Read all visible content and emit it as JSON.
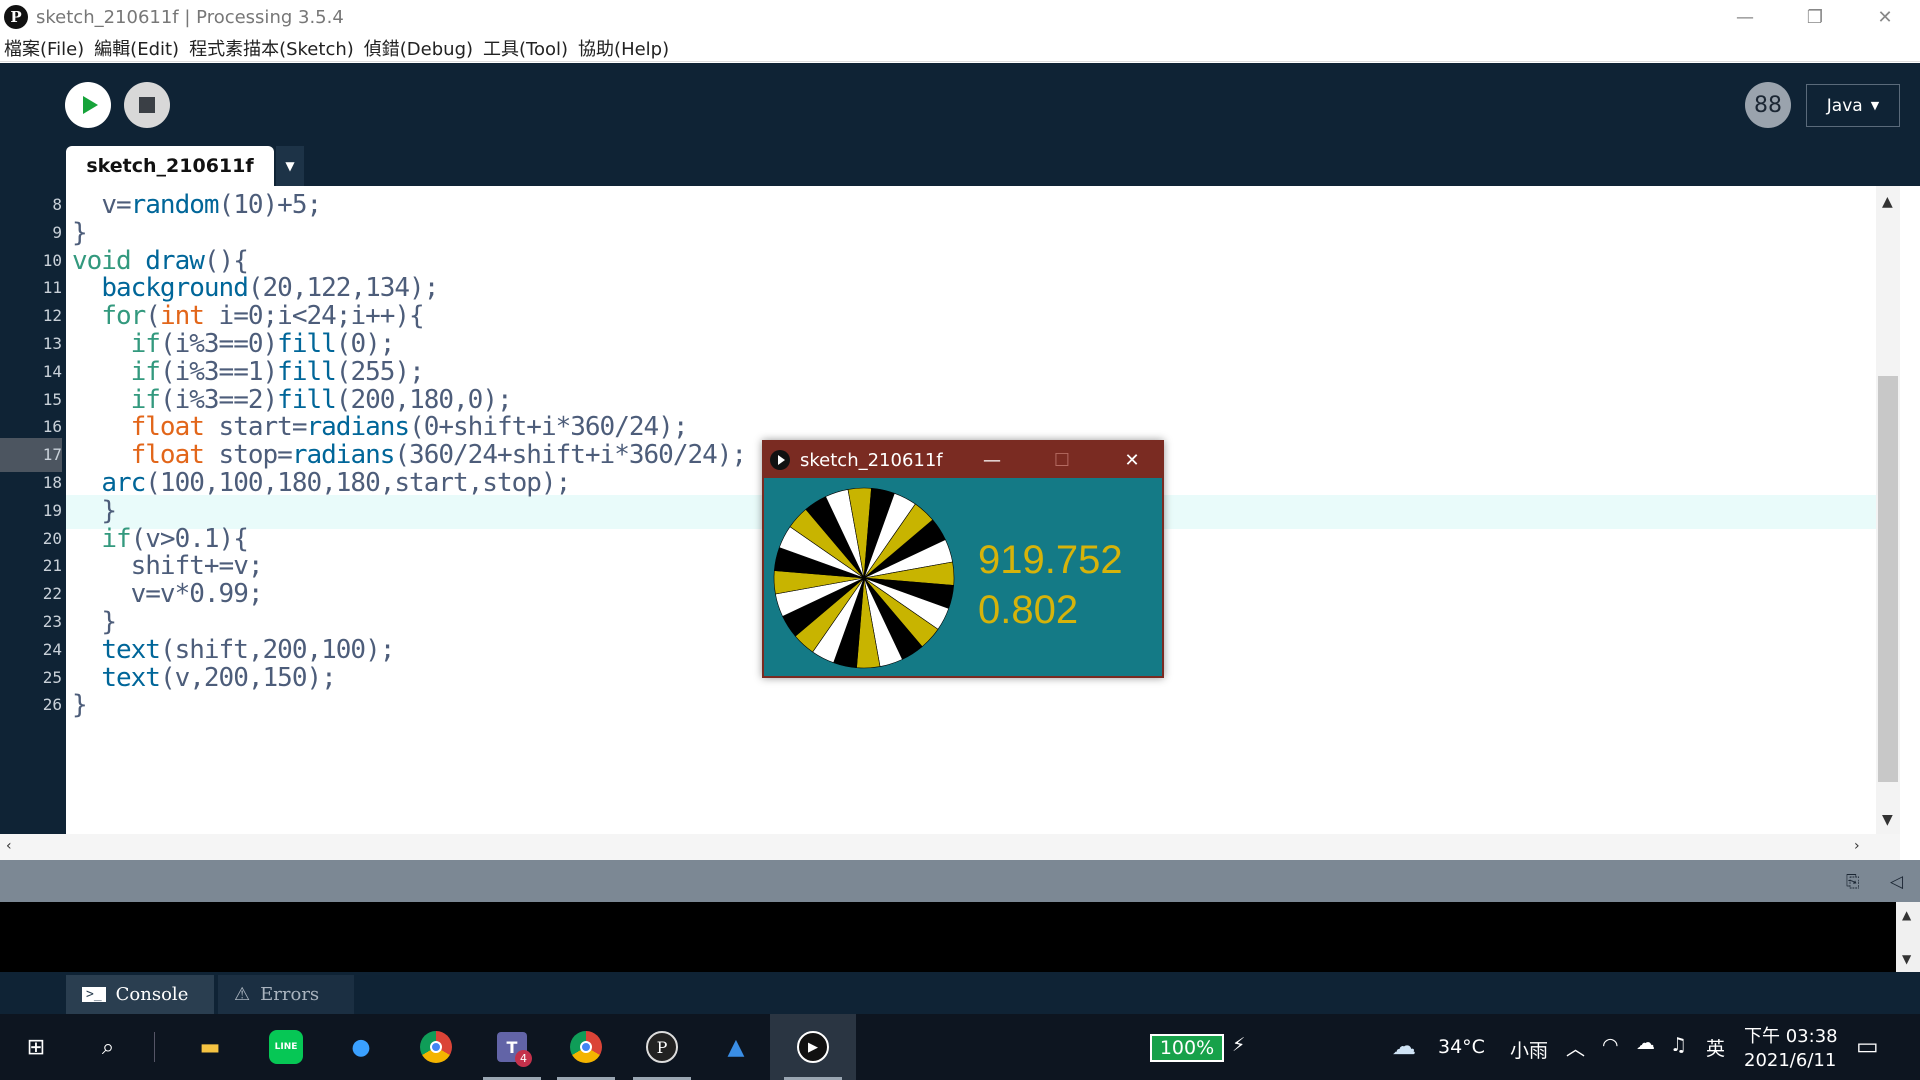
{
  "window": {
    "title": "sketch_210611f | Processing 3.5.4",
    "logo_glyph": "P",
    "minimize": "—",
    "restore": "❐",
    "close": "✕"
  },
  "menu": {
    "items": [
      "檔案(File)",
      "編輯(Edit)",
      "程式素描本(Sketch)",
      "偵錯(Debug)",
      "工具(Tool)",
      "協助(Help)"
    ]
  },
  "toolbar": {
    "mode_label": "Java",
    "mode_arrow": "▼",
    "mode_icon": "88"
  },
  "tabs": {
    "active": "sketch_210611f",
    "menu_arrow": "▼"
  },
  "editor": {
    "lines": [
      {
        "num": "8",
        "indent": "  ",
        "parts": [
          [
            "pl",
            "v="
          ],
          [
            "fn",
            "random"
          ],
          [
            "pl",
            "(10)+5;"
          ]
        ]
      },
      {
        "num": "9",
        "indent": "",
        "parts": [
          [
            "pl",
            "}"
          ]
        ]
      },
      {
        "num": "10",
        "indent": "",
        "parts": [
          [
            "kw",
            "void "
          ],
          [
            "fn",
            "draw"
          ],
          [
            "pl",
            "(){"
          ]
        ]
      },
      {
        "num": "11",
        "indent": "  ",
        "parts": [
          [
            "fn",
            "background"
          ],
          [
            "pl",
            "(20,122,134);"
          ]
        ]
      },
      {
        "num": "12",
        "indent": "  ",
        "parts": [
          [
            "kw",
            "for"
          ],
          [
            "pl",
            "("
          ],
          [
            "tp",
            "int"
          ],
          [
            "pl",
            " i=0;i<24;i++){"
          ]
        ]
      },
      {
        "num": "13",
        "indent": "    ",
        "parts": [
          [
            "kw",
            "if"
          ],
          [
            "pl",
            "(i%3==0)"
          ],
          [
            "fn",
            "fill"
          ],
          [
            "pl",
            "(0);"
          ]
        ]
      },
      {
        "num": "14",
        "indent": "    ",
        "parts": [
          [
            "kw",
            "if"
          ],
          [
            "pl",
            "(i%3==1)"
          ],
          [
            "fn",
            "fill"
          ],
          [
            "pl",
            "(255);"
          ]
        ]
      },
      {
        "num": "15",
        "indent": "    ",
        "parts": [
          [
            "kw",
            "if"
          ],
          [
            "pl",
            "(i%3==2)"
          ],
          [
            "fn",
            "fill"
          ],
          [
            "pl",
            "(200,180,0);"
          ]
        ]
      },
      {
        "num": "16",
        "indent": "    ",
        "parts": [
          [
            "tp",
            "float"
          ],
          [
            "pl",
            " start="
          ],
          [
            "fn",
            "radians"
          ],
          [
            "pl",
            "(0+shift+i*360/24);"
          ]
        ]
      },
      {
        "num": "17",
        "indent": "    ",
        "parts": [
          [
            "tp",
            "float"
          ],
          [
            "pl",
            " stop="
          ],
          [
            "fn",
            "radians"
          ],
          [
            "pl",
            "(360/24+shift+i*360/24);"
          ]
        ]
      },
      {
        "num": "18",
        "indent": "  ",
        "parts": [
          [
            "fn",
            "arc"
          ],
          [
            "pl",
            "(100,100,180,180,start,stop);"
          ]
        ]
      },
      {
        "num": "19",
        "indent": "  ",
        "parts": [
          [
            "pl",
            "}"
          ]
        ]
      },
      {
        "num": "20",
        "indent": "  ",
        "parts": [
          [
            "kw",
            "if"
          ],
          [
            "pl",
            "(v>0.1){"
          ]
        ]
      },
      {
        "num": "21",
        "indent": "    ",
        "parts": [
          [
            "pl",
            "shift+=v;"
          ]
        ]
      },
      {
        "num": "22",
        "indent": "    ",
        "parts": [
          [
            "pl",
            "v=v*0.99;"
          ]
        ]
      },
      {
        "num": "23",
        "indent": "  ",
        "parts": [
          [
            "pl",
            "}"
          ]
        ]
      },
      {
        "num": "24",
        "indent": "  ",
        "parts": [
          [
            "fn",
            "text"
          ],
          [
            "pl",
            "(shift,200,100);"
          ]
        ]
      },
      {
        "num": "25",
        "indent": "  ",
        "parts": [
          [
            "fn",
            "text"
          ],
          [
            "pl",
            "(v,200,150);"
          ]
        ]
      },
      {
        "num": "26",
        "indent": "",
        "parts": [
          [
            "pl",
            "}"
          ]
        ]
      }
    ],
    "current_line": "17"
  },
  "console_tabs": {
    "console": "Console",
    "errors": "Errors"
  },
  "sketch_window": {
    "title": "sketch_210611f",
    "shift_value": "919.752",
    "v_value": "0.802",
    "background": "#147a86",
    "colors": [
      "#000000",
      "#ffffff",
      "#c8b400"
    ],
    "segments": 24,
    "start_angle_deg": 319.752
  },
  "taskbar": {
    "battery": "100%",
    "weather_temp": "34°C",
    "weather_desc": "小雨",
    "ime": "英",
    "time": "下午 03:38",
    "date": "2021/6/11",
    "teams_badge": "4"
  }
}
